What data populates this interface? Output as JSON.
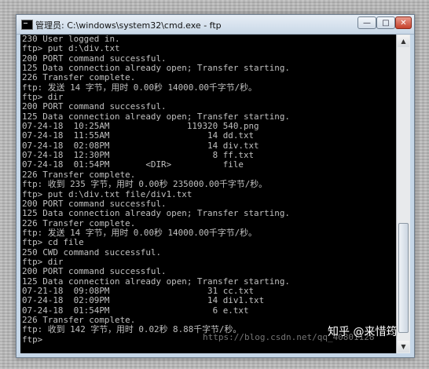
{
  "window": {
    "title": "管理员: C:\\windows\\system32\\cmd.exe - ftp",
    "controls": {
      "minimize": "—",
      "maximize": "□",
      "close": "✕"
    }
  },
  "console": {
    "lines": [
      "230 User logged in.",
      "ftp> put d:\\div.txt",
      "200 PORT command successful.",
      "125 Data connection already open; Transfer starting.",
      "226 Transfer complete.",
      "ftp: 发送 14 字节，用时 0.00秒 14000.00千字节/秒。",
      "ftp> dir",
      "200 PORT command successful.",
      "125 Data connection already open; Transfer starting.",
      "07-24-18  10:25AM               119320 540.png",
      "07-24-18  11:55AM                   14 dd.txt",
      "07-24-18  02:08PM                   14 div.txt",
      "07-24-18  12:30PM                    8 ff.txt",
      "07-24-18  01:54PM       <DIR>          file",
      "226 Transfer complete.",
      "ftp: 收到 235 字节，用时 0.00秒 235000.00千字节/秒。",
      "ftp> put d:\\div.txt file/div1.txt",
      "200 PORT command successful.",
      "125 Data connection already open; Transfer starting.",
      "226 Transfer complete.",
      "ftp: 发送 14 字节，用时 0.00秒 14000.00千字节/秒。",
      "ftp> cd file",
      "250 CWD command successful.",
      "ftp> dir",
      "200 PORT command successful.",
      "125 Data connection already open; Transfer starting.",
      "07-21-18  09:08PM                   31 cc.txt",
      "07-24-18  02:09PM                   14 div1.txt",
      "07-24-18  01:54PM                    6 e.txt",
      "226 Transfer complete.",
      "ftp: 收到 142 字节，用时 0.02秒 8.88千字节/秒。",
      "ftp>"
    ]
  },
  "watermark": "https://blog.csdn.net/qq_40801128",
  "brand": "知乎 @来惜筠",
  "scrollbar": {
    "up": "▲",
    "down": "▼"
  }
}
